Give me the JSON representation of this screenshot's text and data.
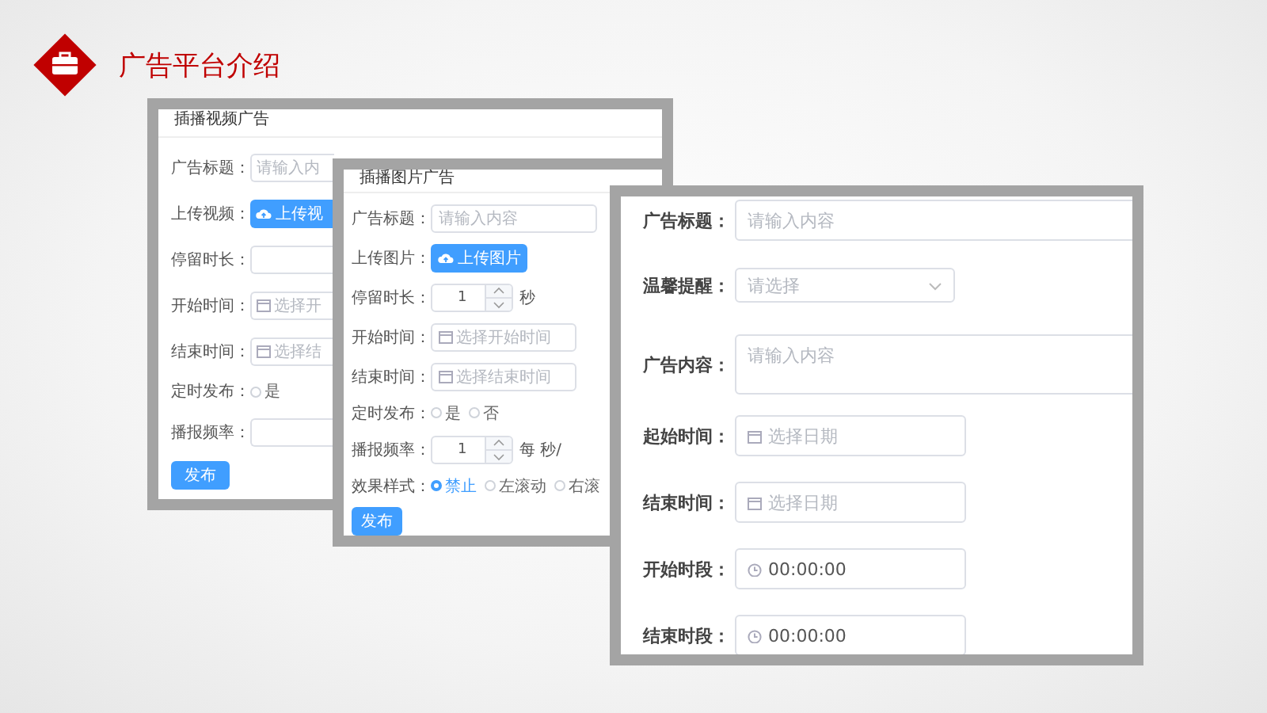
{
  "slide": {
    "title": "广告平台介绍"
  },
  "panels": [
    {
      "title": "插播视频广告",
      "rows": [
        {
          "kind": "input",
          "label": "广告标题：",
          "placeholder": "请输入内"
        },
        {
          "kind": "upload",
          "label": "上传视频：",
          "button": "上传视"
        },
        {
          "kind": "input",
          "label": "停留时长："
        },
        {
          "kind": "date",
          "label": "开始时间：",
          "placeholder": "选择开"
        },
        {
          "kind": "date",
          "label": "结束时间：",
          "placeholder": "选择结"
        },
        {
          "kind": "radio",
          "label": "定时发布：",
          "options": [
            {
              "label": "是",
              "selected": false
            }
          ]
        },
        {
          "kind": "input",
          "label": "播报频率："
        }
      ],
      "submit": "发布"
    },
    {
      "title": "插播图片广告",
      "rows": [
        {
          "kind": "input",
          "label": "广告标题：",
          "placeholder": "请输入内容"
        },
        {
          "kind": "upload",
          "label": "上传图片：",
          "button": "上传图片"
        },
        {
          "kind": "number",
          "label": "停留时长：",
          "value": "1",
          "unit": "秒"
        },
        {
          "kind": "date",
          "label": "开始时间：",
          "placeholder": "选择开始时间"
        },
        {
          "kind": "date",
          "label": "结束时间：",
          "placeholder": "选择结束时间"
        },
        {
          "kind": "radio",
          "label": "定时发布：",
          "options": [
            {
              "label": "是",
              "selected": false
            },
            {
              "label": "否",
              "selected": false
            }
          ]
        },
        {
          "kind": "number",
          "label": "播报频率：",
          "value": "1",
          "unit": "每 秒/"
        },
        {
          "kind": "radio",
          "label": "效果样式：",
          "options": [
            {
              "label": "禁止",
              "selected": true
            },
            {
              "label": "左滚动",
              "selected": false
            },
            {
              "label": "右滚",
              "selected": false
            }
          ]
        }
      ],
      "submit": "发布"
    },
    {
      "rows": [
        {
          "kind": "input",
          "label": "广告标题：",
          "placeholder": "请输入内容"
        },
        {
          "kind": "select",
          "label": "温馨提醒：",
          "placeholder": "请选择"
        },
        {
          "kind": "textarea",
          "label": "广告内容：",
          "placeholder": "请输入内容"
        },
        {
          "kind": "date",
          "label": "起始时间：",
          "placeholder": "选择日期"
        },
        {
          "kind": "date",
          "label": "结束时间：",
          "placeholder": "选择日期"
        },
        {
          "kind": "time",
          "label": "开始时段：",
          "value": "00:00:00"
        },
        {
          "kind": "time",
          "label": "结束时段：",
          "value": "00:00:00"
        }
      ]
    }
  ]
}
